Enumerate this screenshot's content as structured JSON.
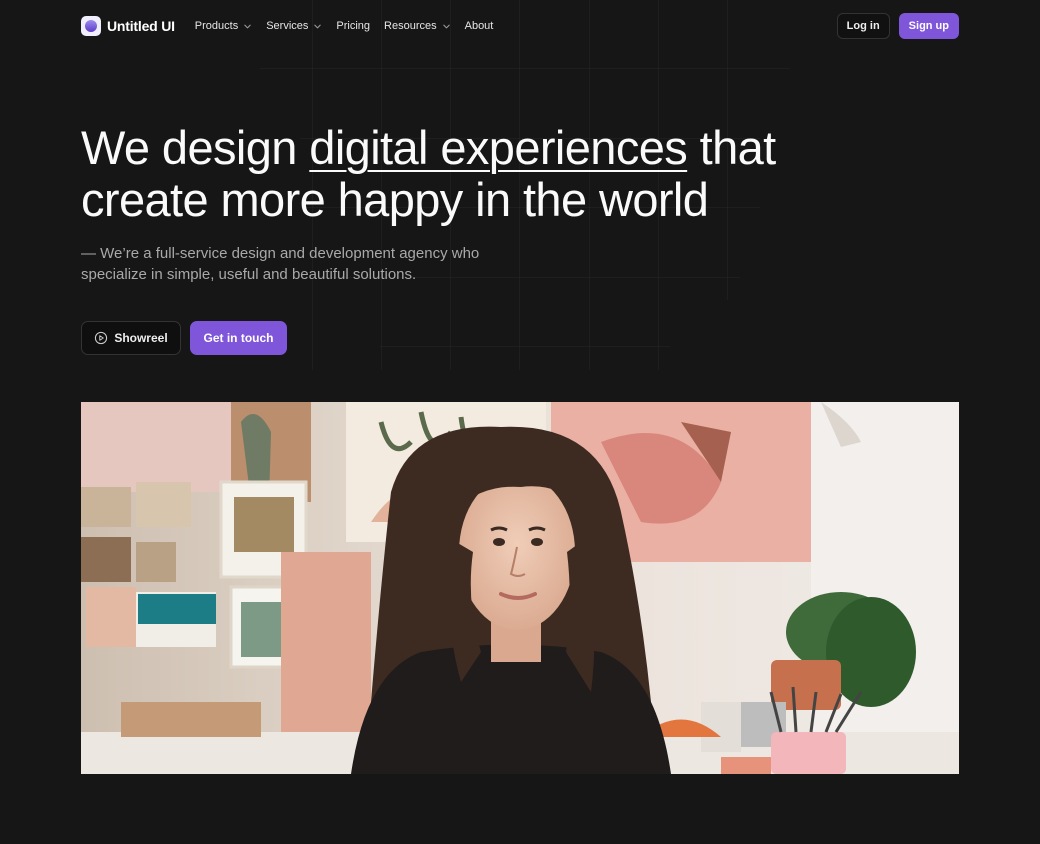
{
  "brand": {
    "name": "Untitled UI"
  },
  "nav": {
    "items": [
      {
        "label": "Products",
        "has_dropdown": true
      },
      {
        "label": "Services",
        "has_dropdown": true
      },
      {
        "label": "Pricing",
        "has_dropdown": false
      },
      {
        "label": "Resources",
        "has_dropdown": true
      },
      {
        "label": "About",
        "has_dropdown": false
      }
    ],
    "login_label": "Log in",
    "signup_label": "Sign up"
  },
  "hero": {
    "headline_part1": "We design ",
    "headline_highlight": "digital experiences",
    "headline_part2": " that create more happy in the world",
    "subheading": "— We’re a full-service design and development agency who specialize in simple, useful and beautiful solutions.",
    "showreel_label": "Showreel",
    "contact_label": "Get in touch"
  },
  "colors": {
    "background": "#161616",
    "accent": "#7f56d9"
  },
  "icons": {
    "logo": "logo-mark-icon",
    "dropdown": "chevron-down-icon",
    "showreel": "play-circle-icon"
  }
}
